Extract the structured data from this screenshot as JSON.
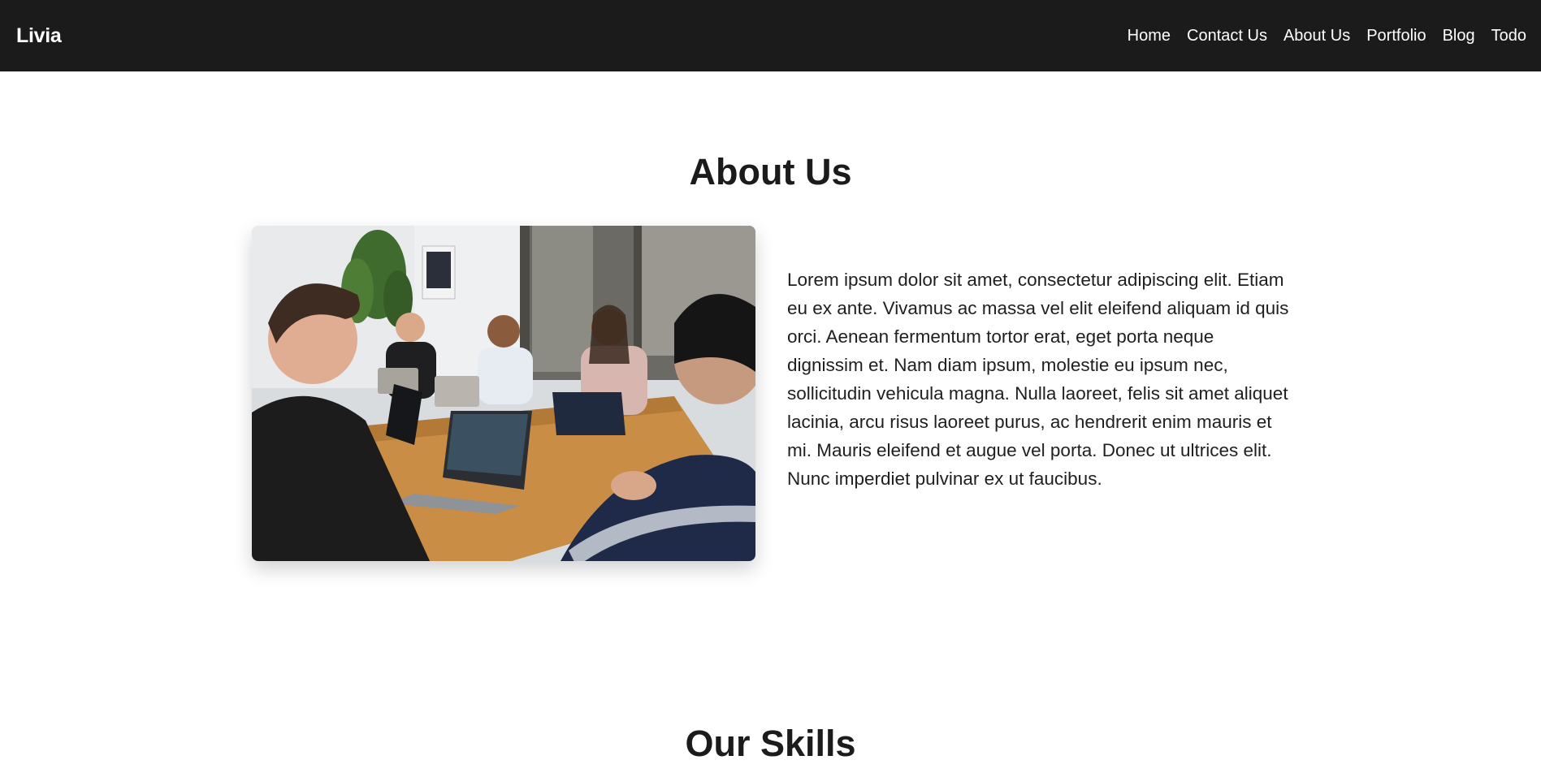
{
  "navbar": {
    "brand": "Livia",
    "links": [
      "Home",
      "Contact Us",
      "About Us",
      "Portfolio",
      "Blog",
      "Todo"
    ]
  },
  "about": {
    "title": "About Us",
    "image_icon": "team-meeting-photo",
    "paragraph": "Lorem ipsum dolor sit amet, consectetur adipiscing elit. Etiam eu ex ante. Vivamus ac massa vel elit eleifend aliquam id quis orci. Aenean fermentum tortor erat, eget porta neque dignissim et. Nam diam ipsum, molestie eu ipsum nec, sollicitudin vehicula magna. Nulla laoreet, felis sit amet aliquet lacinia, arcu risus laoreet purus, ac hendrerit enim mauris et mi. Mauris eleifend et augue vel porta. Donec ut ultrices elit. Nunc imperdiet pulvinar ex ut faucibus."
  },
  "skills": {
    "title": "Our Skills"
  },
  "colors": {
    "navbar_bg": "#1b1b1b",
    "text": "#1b1b1b",
    "background": "#ffffff"
  }
}
